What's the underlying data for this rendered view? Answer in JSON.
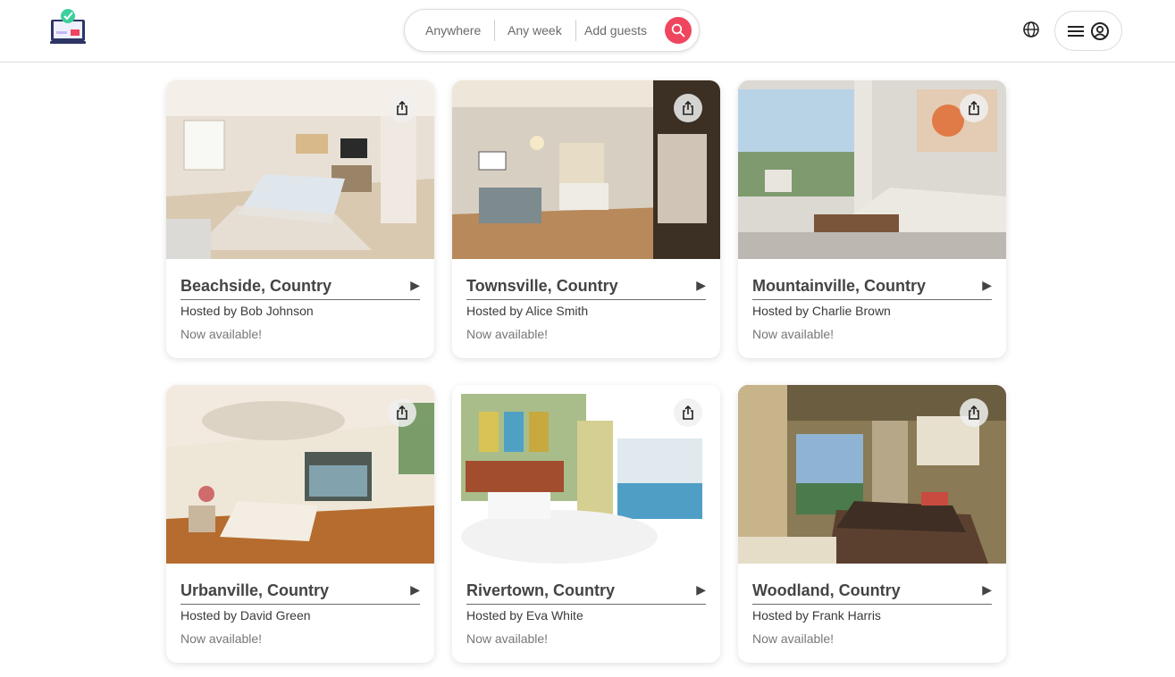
{
  "header": {
    "search": {
      "anywhere": "Anywhere",
      "any_week": "Any week",
      "add_guests": "Add guests",
      "search_icon": "search-icon",
      "accent": "#f0455f"
    },
    "globe_icon": "globe-icon",
    "menu_icon": "hamburger-icon",
    "account_icon": "user-circle-icon"
  },
  "listings": [
    {
      "title": "Beachside, Country",
      "host": "Hosted by Bob Johnson",
      "status": "Now available!"
    },
    {
      "title": "Townsville, Country",
      "host": "Hosted by Alice Smith",
      "status": "Now available!"
    },
    {
      "title": "Mountainville, Country",
      "host": "Hosted by Charlie Brown",
      "status": "Now available!"
    },
    {
      "title": "Urbanville, Country",
      "host": "Hosted by David Green",
      "status": "Now available!"
    },
    {
      "title": "Rivertown, Country",
      "host": "Hosted by Eva White",
      "status": "Now available!"
    },
    {
      "title": "Woodland, Country",
      "host": "Hosted by Frank Harris",
      "status": "Now available!"
    }
  ],
  "listing_arrow": "▶"
}
